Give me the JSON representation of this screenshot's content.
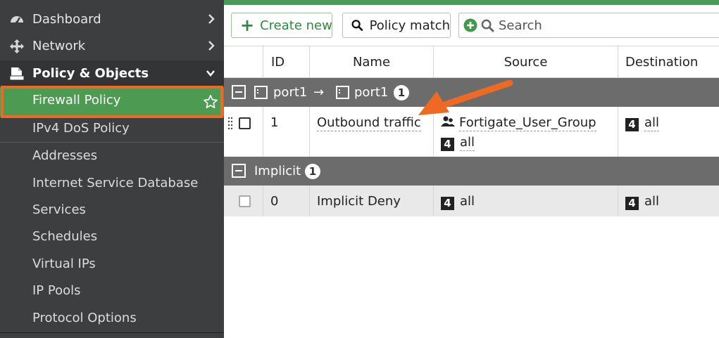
{
  "sidebar": {
    "items": [
      {
        "label": "Dashboard"
      },
      {
        "label": "Network"
      },
      {
        "label": "Policy & Objects"
      },
      {
        "label": "Firewall Policy"
      },
      {
        "label": "IPv4 DoS Policy"
      },
      {
        "label": "Addresses"
      },
      {
        "label": "Internet Service Database"
      },
      {
        "label": "Services"
      },
      {
        "label": "Schedules"
      },
      {
        "label": "Virtual IPs"
      },
      {
        "label": "IP Pools"
      },
      {
        "label": "Protocol Options"
      }
    ]
  },
  "toolbar": {
    "create_label": "Create new",
    "match_label": "Policy match",
    "search_placeholder": "Search"
  },
  "table": {
    "columns": [
      "ID",
      "Name",
      "Source",
      "Destination"
    ],
    "groups": [
      {
        "from": "port1",
        "arrow": "→",
        "to": "port1",
        "count": "1",
        "rows": [
          {
            "id": "1",
            "name": "Outbound traffic",
            "source": [
              "Fortigate_User_Group",
              "all"
            ],
            "destination": "all"
          }
        ]
      },
      {
        "label": "Implicit",
        "count": "1",
        "rows": [
          {
            "id": "0",
            "name": "Implicit Deny",
            "source": [
              "all"
            ],
            "destination": "all"
          }
        ]
      }
    ]
  },
  "icons": {
    "address_glyph": "4"
  },
  "colors": {
    "sidebar_bg": "#3d3e3f",
    "active_green": "#4d9a52",
    "highlight_orange": "#ee6a23",
    "group_row_bg": "#6c6c6c",
    "create_green": "#2e8a3c"
  }
}
